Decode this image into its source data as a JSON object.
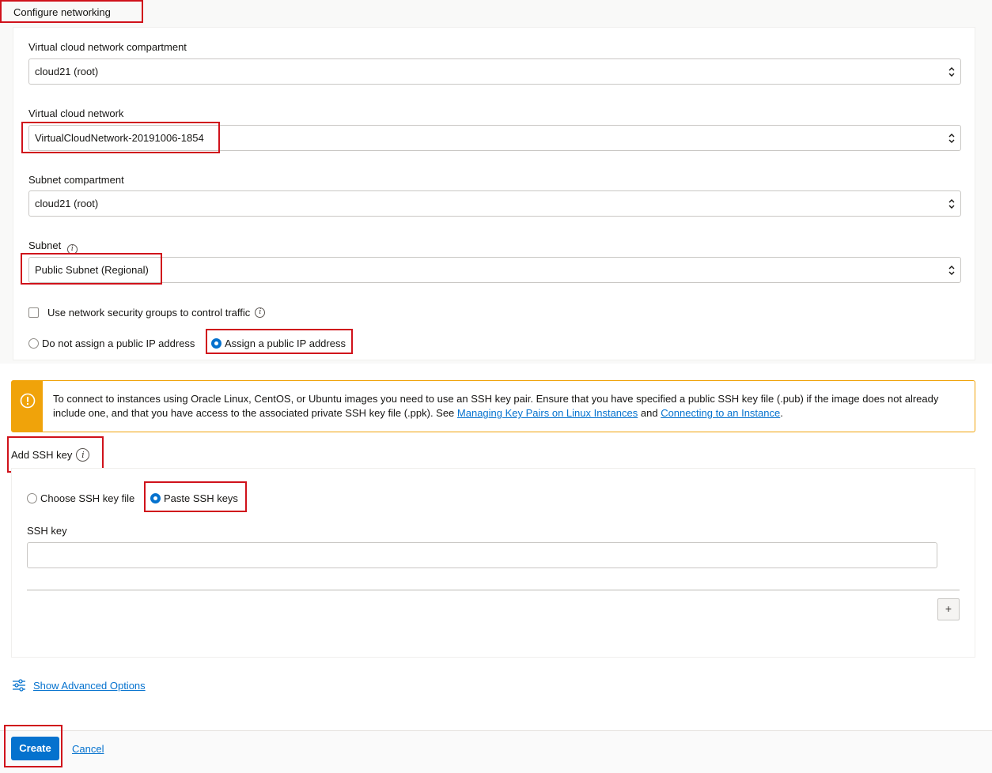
{
  "networking": {
    "section_title": "Configure networking",
    "vcn_compartment": {
      "label": "Virtual cloud network compartment",
      "value": "cloud21 (root)"
    },
    "vcn": {
      "label": "Virtual cloud network",
      "value": "VirtualCloudNetwork-20191006-1854"
    },
    "subnet_compartment": {
      "label": "Subnet compartment",
      "value": "cloud21 (root)"
    },
    "subnet": {
      "label": "Subnet",
      "value": "Public Subnet (Regional)"
    },
    "nsg_checkbox_label": "Use network security groups to control traffic",
    "ip_options": [
      {
        "label": "Do not assign a public IP address",
        "selected": false
      },
      {
        "label": "Assign a public IP address",
        "selected": true
      }
    ]
  },
  "warning": {
    "text_before": "To connect to instances using Oracle Linux, CentOS, or Ubuntu images you need to use an SSH key pair. Ensure that you have specified a public SSH key file (.pub) if the image does not already include one, and that you have access to the associated private SSH key file (.ppk). See ",
    "link1": "Managing Key Pairs on Linux Instances",
    "text_middle": " and ",
    "link2": "Connecting to an Instance",
    "text_after": ".",
    "icon": "warning-icon"
  },
  "ssh": {
    "section_title": "Add SSH key",
    "options": [
      {
        "label": "Choose SSH key file",
        "selected": false
      },
      {
        "label": "Paste SSH keys",
        "selected": true
      }
    ],
    "key_label": "SSH key",
    "key_value": "",
    "add_button": "+"
  },
  "advanced_options_link": "Show Advanced Options",
  "footer": {
    "create_label": "Create",
    "cancel_label": "Cancel"
  },
  "colors": {
    "accent": "#0572ce",
    "warning": "#f0a30a",
    "highlight": "#d0121b"
  }
}
